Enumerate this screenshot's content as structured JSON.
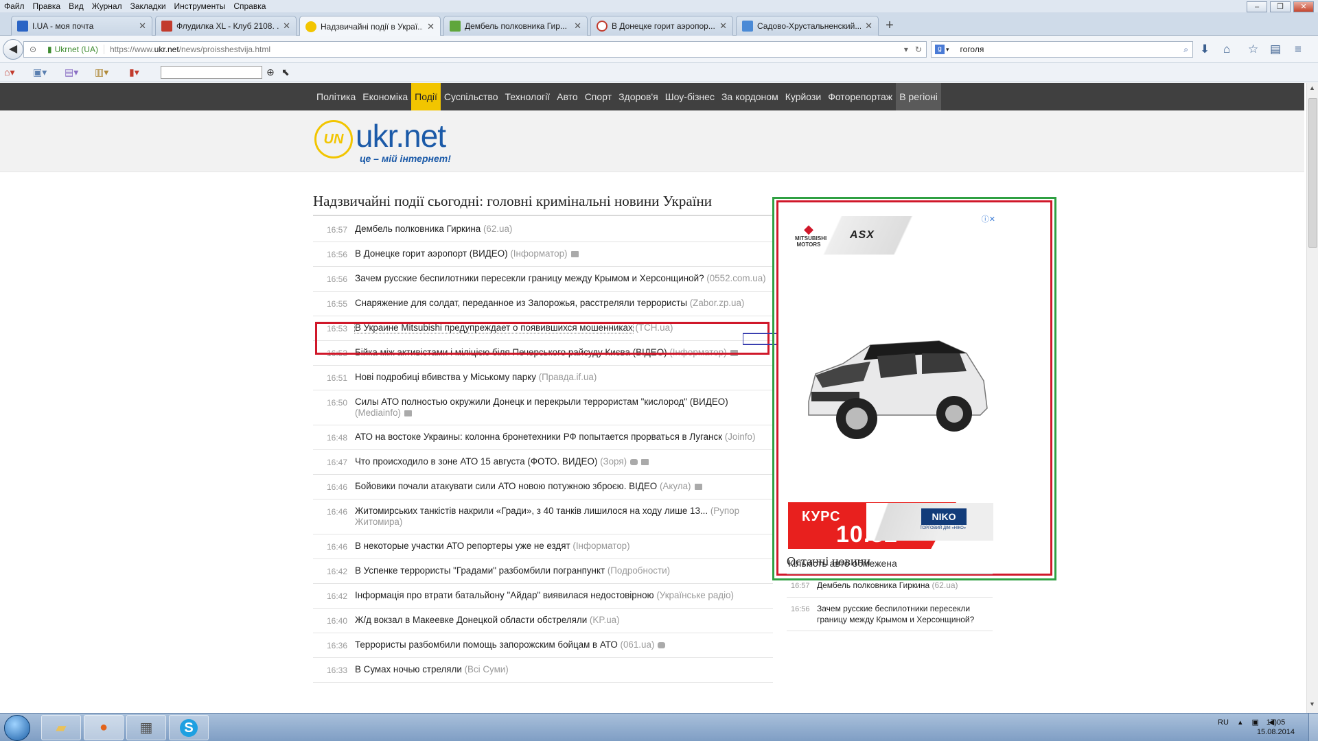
{
  "menubar": {
    "items": [
      "Файл",
      "Правка",
      "Вид",
      "Журнал",
      "Закладки",
      "Инструменты",
      "Справка"
    ]
  },
  "tabs": [
    {
      "title": "I.UA - моя почта",
      "favicon_color": "#2a64c5",
      "active": false
    },
    {
      "title": "Флудилка XL - Клуб 2108. ...",
      "favicon_color": "#c23b2d",
      "active": false
    },
    {
      "title": "Надзвичайні події в Украї...",
      "favicon_color": "#f2c500",
      "active": true
    },
    {
      "title": "Дембель полковника Гир...",
      "favicon_color": "#5fa63b",
      "active": false
    },
    {
      "title": "В Донецке горит аэропор...",
      "favicon_color": "#c23b2d",
      "active": false
    },
    {
      "title": "Садово-Хрустальненский...",
      "favicon_color": "#4a8ad6",
      "active": false
    }
  ],
  "navbar": {
    "site_identity": "Ukrnet (UA)",
    "url_prefix": "https://www.",
    "url_domain": "ukr.net",
    "url_path": "/news/proisshestvija.html",
    "search_engine": "g",
    "search_value": "гоголя"
  },
  "site": {
    "nav": [
      "Політика",
      "Економіка",
      "Події",
      "Суспільство",
      "Технології",
      "Авто",
      "Спорт",
      "Здоров'я",
      "Шоу-бізнес",
      "За кордоном",
      "Курйози",
      "Фоторепортаж",
      "В регіоні"
    ],
    "nav_selected": "Події",
    "logo_mark": "UN",
    "logo_text": "ukr.net",
    "logo_tagline": "це – мій інтернет!",
    "heading": "Надзвичайні події сьогодні: головні кримінальні новини України"
  },
  "news": [
    {
      "time": "16:57",
      "text": "Дембель полковника Гиркина",
      "source": "(62.ua)",
      "icons": []
    },
    {
      "time": "16:56",
      "text": "В Донецке горит аэропорт (ВИДЕО)",
      "source": "(Інформатор)",
      "icons": [
        "video"
      ]
    },
    {
      "time": "16:56",
      "text": "Зачем русские беспилотники пересекли границу между Крымом и Херсонщиной?",
      "source": "(0552.com.ua)",
      "icons": []
    },
    {
      "time": "16:55",
      "text": "Снаряжение для солдат, переданное из Запорожья, расстреляли террористы",
      "source": "(Zabor.zp.ua)",
      "icons": []
    },
    {
      "time": "16:53",
      "text": "В Украине Mitsubishi предупреждает о появившихся мошенниках",
      "source": "(ТСН.ua)",
      "icons": [],
      "highlight": true
    },
    {
      "time": "16:53",
      "text": "Бійка між активістами і міліцією біля Печерського райсуду Києва (ВІДЕО)",
      "source": "(Інформатор)",
      "icons": [
        "video"
      ]
    },
    {
      "time": "16:51",
      "text": "Нові подробиці вбивства у Міському парку",
      "source": "(Правда.if.ua)",
      "icons": []
    },
    {
      "time": "16:50",
      "text": "Силы АТО полностью окружили Донецк и перекрыли террористам \"кислород\" (ВИДЕО)",
      "source": "(Mediainfo)",
      "icons": [
        "video"
      ]
    },
    {
      "time": "16:48",
      "text": "АТО на востоке Украины: колонна бронетехники РФ попытается прорваться в Луганск",
      "source": "(Joinfo)",
      "icons": []
    },
    {
      "time": "16:47",
      "text": "Что происходило в зоне АТО 15 августа (ФОТО. ВИДЕО)",
      "source": "(Зоря)",
      "icons": [
        "photo",
        "video"
      ]
    },
    {
      "time": "16:46",
      "text": "Бойовики почали атакувати сили АТО новою потужною зброєю. ВІДЕО",
      "source": "(Акула)",
      "icons": [
        "video"
      ]
    },
    {
      "time": "16:46",
      "text": "Житомирських танкістів накрили «Гради», з 40 танків лишилося на ходу лише 13...",
      "source": "(Рупор Житомира)",
      "icons": []
    },
    {
      "time": "16:46",
      "text": "В некоторые участки АТО репортеры уже не ездят",
      "source": "(Інформатор)",
      "icons": []
    },
    {
      "time": "16:42",
      "text": "В Успенке террористы \"Градами\" разбомбили погранпункт",
      "source": "(Подробности)",
      "icons": []
    },
    {
      "time": "16:42",
      "text": "Інформація про втрати батальйону \"Айдар\" виявилася недостовірною",
      "source": "(Українське радіо)",
      "icons": []
    },
    {
      "time": "16:40",
      "text": "Ж/д вокзал в Макеевке Донецкой области обстреляли",
      "source": "(KP.ua)",
      "icons": []
    },
    {
      "time": "16:36",
      "text": "Террористы разбомбили помощь запорожским бойцам в АТО",
      "source": "(061.ua)",
      "icons": [
        "photo"
      ]
    },
    {
      "time": "16:33",
      "text": "В Сумах ночью стреляли",
      "source": "(Всі Суми)",
      "icons": []
    }
  ],
  "ad": {
    "brand": "MITSUBISHI MOTORS",
    "model": "ASX",
    "kurs_label": "КУРС",
    "kurs_value": "10.82",
    "bottom": "Кількість авто обмежена",
    "niko": "NIKO",
    "niko_sub": "ТОРГОВИЙ ДІМ «НІКО»"
  },
  "last_news": {
    "title": "Останні новини",
    "items": [
      {
        "time": "16:57",
        "text": "Дембель полковника Гиркина",
        "source": "(62.ua)"
      },
      {
        "time": "16:56",
        "text": "Зачем русские беспилотники пересекли границу между Крымом и Херсонщиной?",
        "source": ""
      }
    ]
  },
  "taskbar": {
    "lang": "RU",
    "time": "17:05",
    "date": "15.08.2014"
  },
  "colors": {
    "highlight_red": "#d0182a",
    "ad_green": "#2fa042",
    "arrow_blue": "#3a3fb0",
    "nav_yellow": "#f2c500"
  }
}
